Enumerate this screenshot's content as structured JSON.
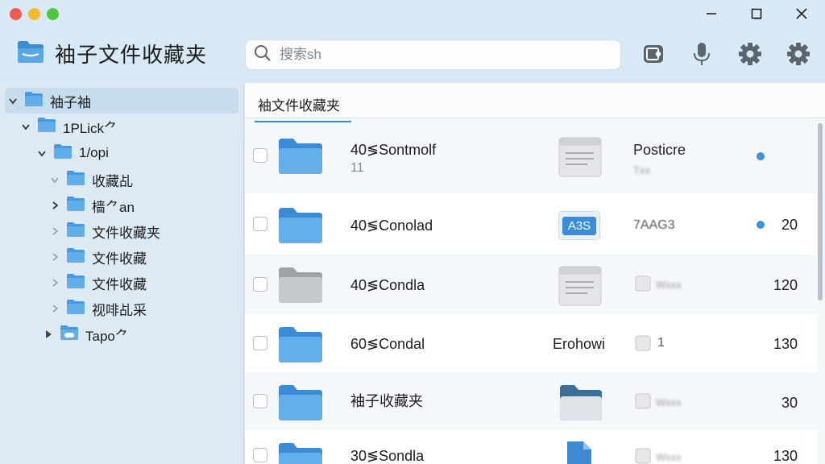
{
  "window": {
    "title": "袖子文件收藏夹",
    "controls": [
      "minimize-icon",
      "maximize-icon",
      "close-icon"
    ]
  },
  "search": {
    "value": "",
    "placeholder": "搜索sh"
  },
  "toolbar": {
    "icons": [
      "screen-record-icon",
      "microphone-icon",
      "gear-icon",
      "gear-icon"
    ]
  },
  "sidebar": {
    "items": [
      {
        "label": "袖子袖",
        "expanded": true,
        "selected": true
      },
      {
        "label": "1PLick⺈",
        "expanded": true
      },
      {
        "label": "1/opi",
        "expanded": true
      },
      {
        "label": "收藏乩",
        "expanded": true
      },
      {
        "label": "樯⺈an",
        "expanded": false
      },
      {
        "label": "文件收藏夹",
        "expanded": false
      },
      {
        "label": "文件收藏",
        "expanded": false
      },
      {
        "label": "文件收藏",
        "expanded": false
      },
      {
        "label": "视啡乩采",
        "expanded": false
      },
      {
        "label": "Tapo⺈",
        "expanded": false
      }
    ]
  },
  "main": {
    "tab": "袖文件收藏夹",
    "rows": [
      {
        "name": "40≶Sontmolf",
        "sub": "11",
        "c2_type": "doc",
        "c3_text": "Posticre",
        "c3_blur": "Txx",
        "dot": true,
        "num": ""
      },
      {
        "name": "40≶Conolad",
        "sub": "",
        "c2_type": "badge",
        "c2_badge": "A3S",
        "c3_text": "7AAG3",
        "dot": true,
        "num": "20"
      },
      {
        "name": "40≶Condla",
        "sub": "",
        "c2_type": "doc",
        "c3_blur": "Wxxx",
        "dot": false,
        "num": "120"
      },
      {
        "name": "60≶Condal",
        "sub": "",
        "c2_type": "text",
        "c2_text": "Erohowi",
        "c3_text": "1",
        "dot": false,
        "num": "130"
      },
      {
        "name": "袖子收藏夹",
        "sub": "",
        "c2_type": "folder",
        "c3_blur": "Wxxx",
        "dot": false,
        "num": "30"
      },
      {
        "name": "30≶Sondla",
        "sub": "",
        "c2_type": "file",
        "c3_blur": "Wxxx",
        "dot": false,
        "num": "130"
      }
    ]
  },
  "colors": {
    "accent": "#3a88d2",
    "folder_blue": "#5aa7e6",
    "folder_gray": "#b8bcc1",
    "status_dot": "#3b93dc"
  }
}
